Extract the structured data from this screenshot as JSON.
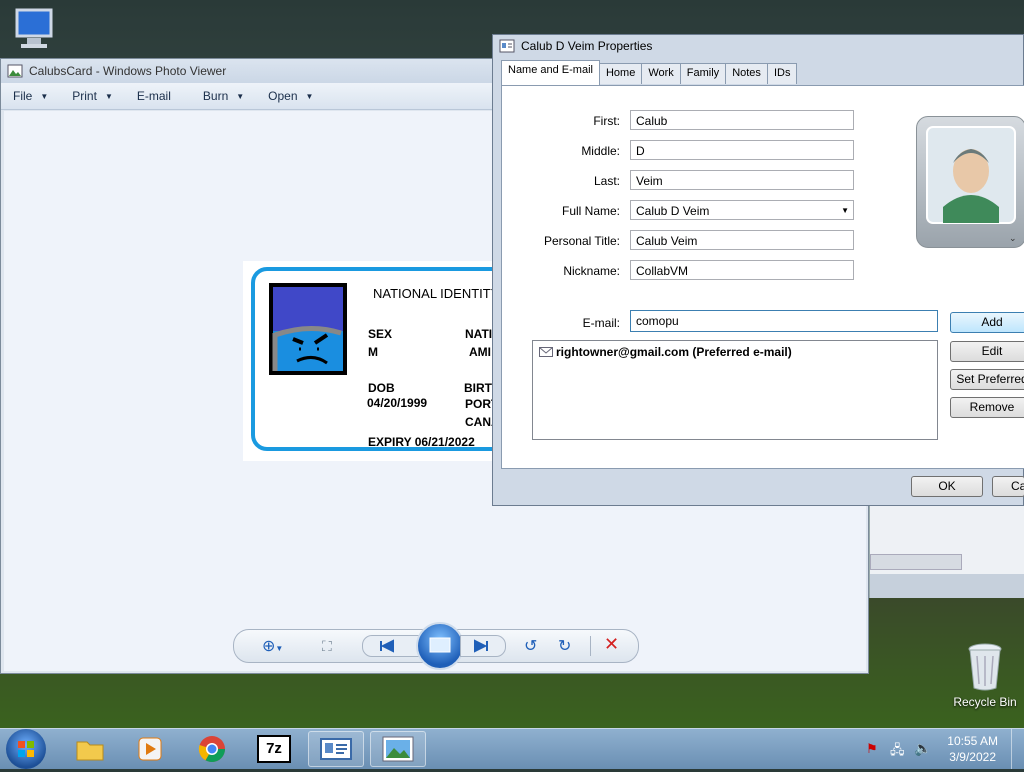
{
  "desktop": {
    "recycle_bin_label": "Recycle Bin"
  },
  "photo_viewer": {
    "title": "CalubsCard - Windows Photo Viewer",
    "menu": [
      {
        "label": "File"
      },
      {
        "label": "Print"
      },
      {
        "label": "E-mail"
      },
      {
        "label": "Burn"
      },
      {
        "label": "Open"
      }
    ],
    "card": {
      "heading": "NATIONAL IDENTITY",
      "sex_label": "SEX",
      "sex_value": "M",
      "nat_label": "NATI",
      "nat_value": "AMI",
      "dob_label": "DOB",
      "dob_value": "04/20/1999",
      "birth_label": "BIRTH",
      "birth_value1": "PORT",
      "birth_value2": "CANA",
      "expiry": "EXPIRY 06/21/2022"
    }
  },
  "properties": {
    "title": "Calub D Veim Properties",
    "tabs": [
      "Name and E-mail",
      "Home",
      "Work",
      "Family",
      "Notes",
      "IDs"
    ],
    "fields": {
      "first_label": "First:",
      "first": "Calub",
      "middle_label": "Middle:",
      "middle": "D",
      "last_label": "Last:",
      "last": "Veim",
      "fullname_label": "Full Name:",
      "fullname": "Calub D Veim",
      "title_label": "Personal Title:",
      "personal_title": "Calub Veim",
      "nickname_label": "Nickname:",
      "nickname": "CollabVM",
      "email_label": "E-mail:",
      "email": "comopu"
    },
    "email_list": [
      "rightowner@gmail.com  (Preferred e-mail)"
    ],
    "buttons": {
      "add": "Add",
      "edit": "Edit",
      "set_preferred": "Set Preferred",
      "remove": "Remove",
      "ok": "OK",
      "cancel": "Ca"
    }
  },
  "taskbar": {
    "time": "10:55 AM",
    "date": "3/9/2022",
    "seven_zip_label": "7z"
  },
  "colors": {
    "card_border": "#1a9ae0",
    "close_red": "#d42020",
    "toolbar_blue": "#1f5fb8"
  }
}
